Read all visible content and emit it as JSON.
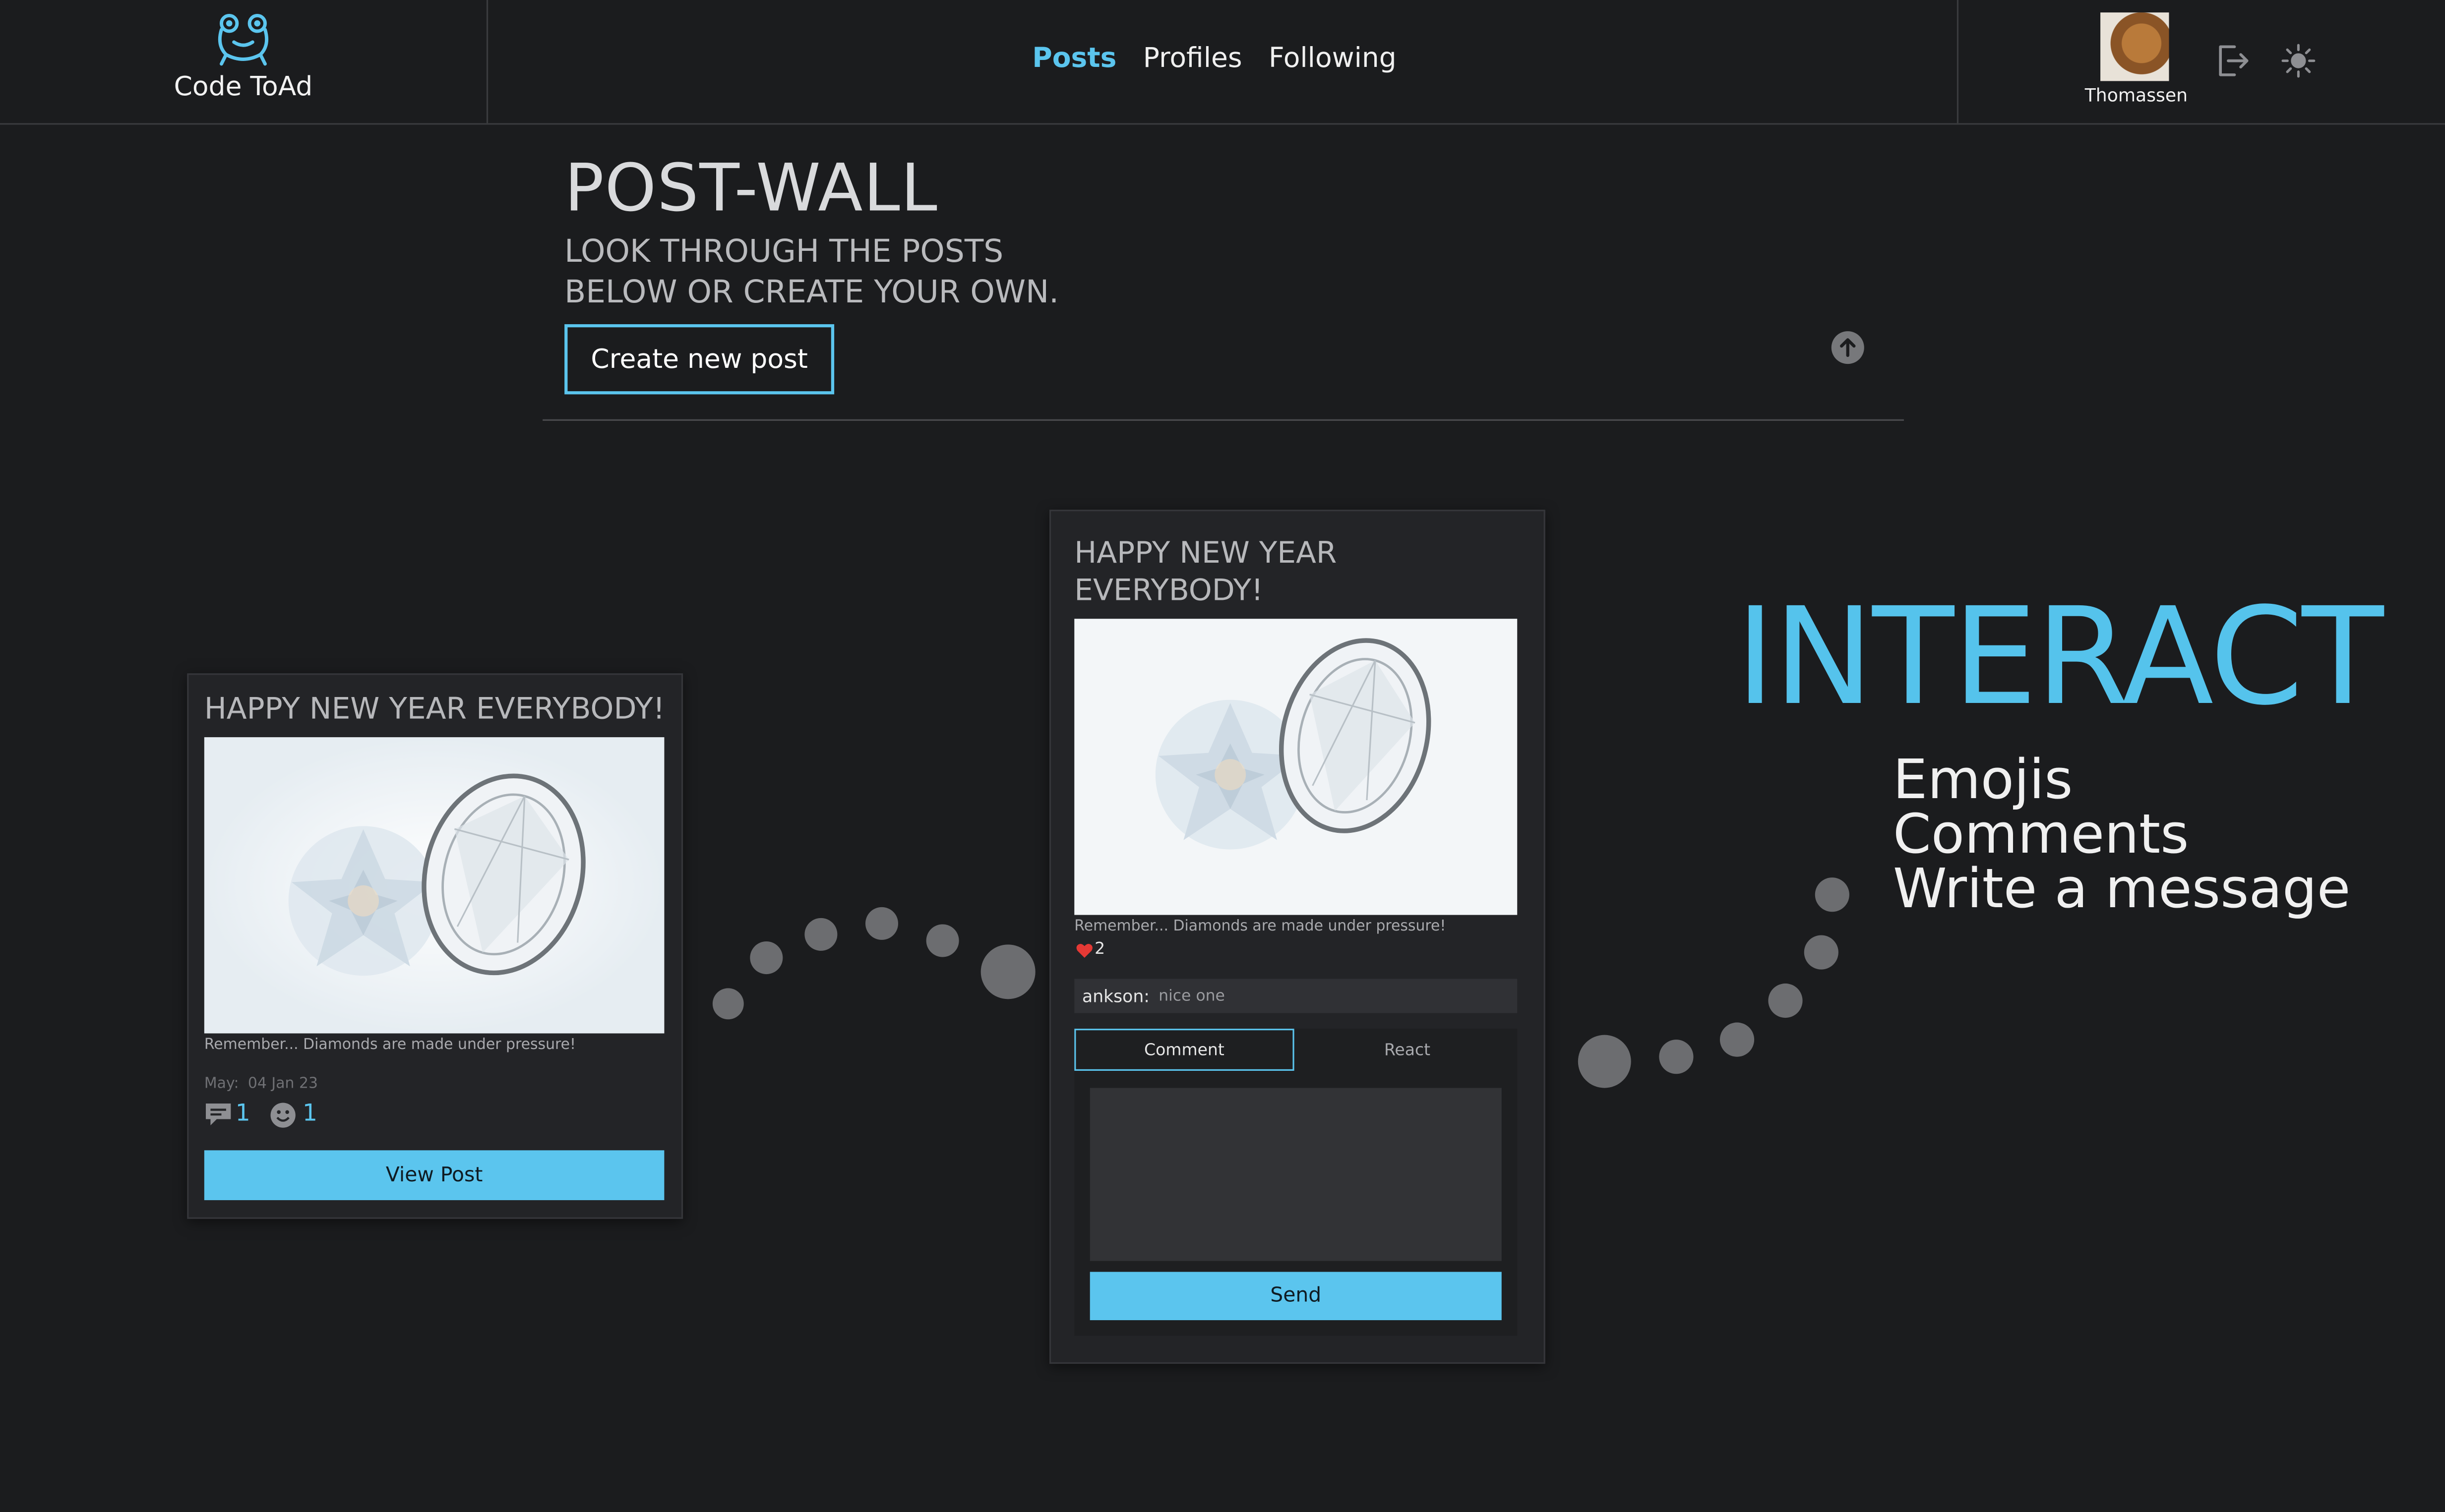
{
  "brand": {
    "name": "Code ToAd",
    "icon": "frog-icon"
  },
  "nav": {
    "posts": "Posts",
    "profiles": "Profiles",
    "following": "Following"
  },
  "user": {
    "name": "Thomassen",
    "logout_icon": "logout-icon",
    "theme_icon": "sun-icon"
  },
  "hero": {
    "title": "POST-WALL",
    "subtitle": "LOOK THROUGH THE POSTS BELOW OR CREATE YOUR OWN.",
    "create_button": "Create new post"
  },
  "feed_card": {
    "title": "HAPPY NEW YEAR EVERYBODY!",
    "caption": "Remember... Diamonds are made under pressure!",
    "author": "May:",
    "date": "04 Jan 23",
    "comment_count": "1",
    "reaction_count": "1",
    "view_button": "View Post"
  },
  "detail_card": {
    "title": "HAPPY NEW YEAR EVERYBODY!",
    "caption": "Remember... Diamonds are made under pressure!",
    "heart_count": "2",
    "comment_author": "ankson:",
    "comment_text": "nice one",
    "tab_comment": "Comment",
    "tab_react": "React",
    "send_button": "Send"
  },
  "promo": {
    "headline": "INTERACT",
    "features": [
      "Emojis",
      "Comments",
      "Write a message"
    ]
  },
  "colors": {
    "accent": "#5bc5ee",
    "background": "#1b1c1e",
    "card": "#232427",
    "heart": "#e53935"
  }
}
